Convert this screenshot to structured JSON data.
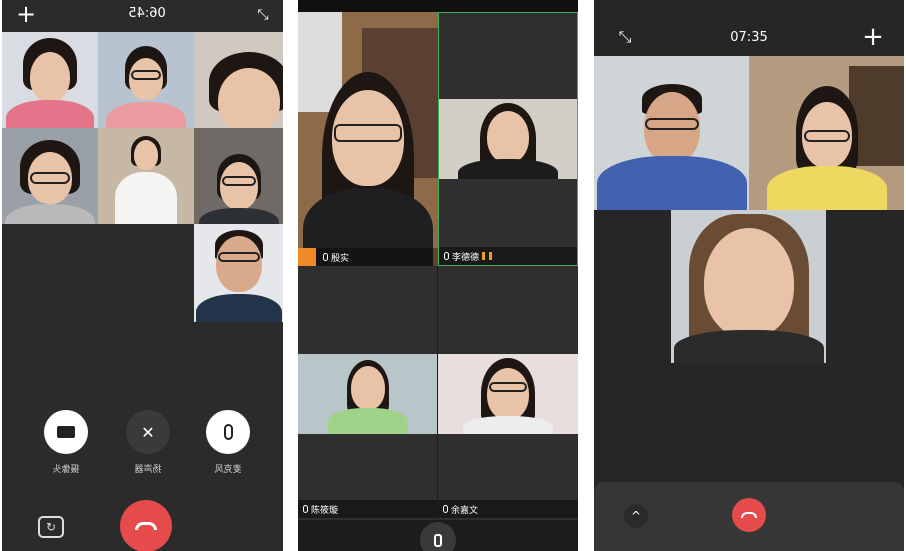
{
  "phone1": {
    "time": "06:45",
    "controls": [
      {
        "label": "摄像头",
        "icon": "camera-icon"
      },
      {
        "label": "扬声器",
        "icon": "speaker-off-icon"
      },
      {
        "label": "麦克风",
        "icon": "microphone-icon"
      }
    ]
  },
  "phone2": {
    "participants": [
      "殷实",
      "李德德",
      "陈筱璇",
      "余嘉文"
    ]
  },
  "phone3": {
    "time": "07:35"
  },
  "colors": {
    "hangup": "#e54b4b",
    "signal": "#f0a020",
    "host_badge": "#f08a24",
    "active_border": "#3fae5a"
  }
}
